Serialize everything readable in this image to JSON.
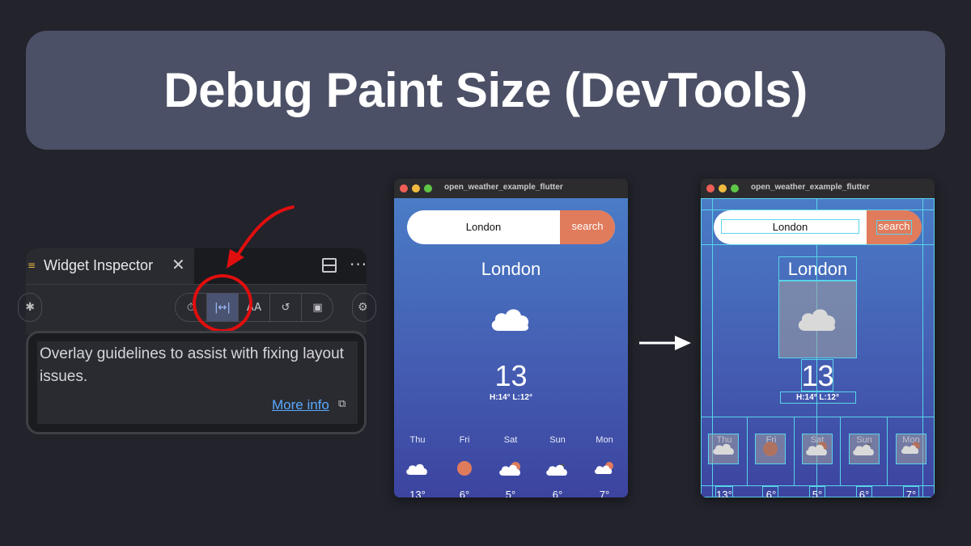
{
  "banner": {
    "title": "Debug Paint Size (DevTools)"
  },
  "inspector": {
    "tab_label": "Widget Inspector",
    "close_glyph": "✕",
    "more_glyph": "···",
    "toolbar": {
      "buttons": [
        {
          "icon": "timer-icon",
          "glyph": "⏱"
        },
        {
          "icon": "debug-paint-size-icon",
          "glyph": "|↔|"
        },
        {
          "icon": "text-baselines-icon",
          "glyph": "AA"
        },
        {
          "icon": "repaint-rainbow-icon",
          "glyph": "↺"
        },
        {
          "icon": "image-icon",
          "glyph": "▣"
        }
      ]
    },
    "tooltip": {
      "text": "Overlay guidelines to assist with fixing layout issues.",
      "link": "More info",
      "link_icon": "⧉"
    }
  },
  "app_before": {
    "window_title": "open_weather_example_flutter",
    "search_value": "London",
    "search_button": "search",
    "city": "London",
    "temp": "13",
    "hilo": "H:14° L:12°",
    "forecast": [
      {
        "day": "Thu",
        "icon": "cloud-icon",
        "temp": "13°"
      },
      {
        "day": "Fri",
        "icon": "sun-icon",
        "temp": "6°"
      },
      {
        "day": "Sat",
        "icon": "sun-behind-cloud-icon",
        "temp": "5°"
      },
      {
        "day": "Sun",
        "icon": "cloud-night-icon",
        "temp": "6°"
      },
      {
        "day": "Mon",
        "icon": "sun-behind-cloud-icon",
        "temp": "7°"
      }
    ]
  },
  "app_after": {
    "window_title": "open_weather_example_flutter",
    "search_value": "London",
    "search_button": "search",
    "city": "London",
    "temp": "13",
    "hilo": "H:14° L:12°",
    "forecast": [
      {
        "day": "Thu",
        "icon": "cloud-icon",
        "temp": "13°"
      },
      {
        "day": "Fri",
        "icon": "sun-icon",
        "temp": "6°"
      },
      {
        "day": "Sat",
        "icon": "sun-behind-cloud-icon",
        "temp": "5°"
      },
      {
        "day": "Sun",
        "icon": "cloud-night-icon",
        "temp": "6°"
      },
      {
        "day": "Mon",
        "icon": "sun-behind-cloud-icon",
        "temp": "7°"
      }
    ]
  },
  "colors": {
    "background": "#22232b",
    "banner": "#4c5066",
    "highlight": "#e10e0e",
    "search_button": "#e07b5c",
    "debug_guides": "#59d4ea",
    "link": "#58aaff"
  }
}
